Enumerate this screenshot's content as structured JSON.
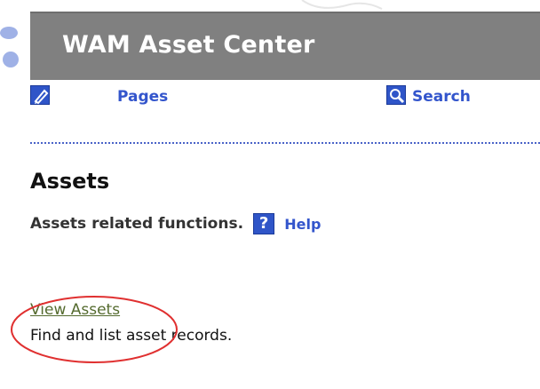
{
  "header": {
    "title": "WAM Asset Center"
  },
  "nav": {
    "pages_label": "Pages",
    "search_label": "Search",
    "pages_icon": "pencil-icon",
    "search_icon": "magnifier-icon"
  },
  "section": {
    "heading": "Assets",
    "description": "Assets related functions.",
    "help_icon_glyph": "?",
    "help_label": "Help"
  },
  "links": {
    "view_assets": "View Assets",
    "view_assets_description": "Find and list asset records."
  },
  "colors": {
    "header_bar": "#808080",
    "link_blue": "#3355cc",
    "icon_blue": "#2f55c8",
    "view_assets_link": "#556b2f",
    "annotation_red": "#e03030"
  }
}
